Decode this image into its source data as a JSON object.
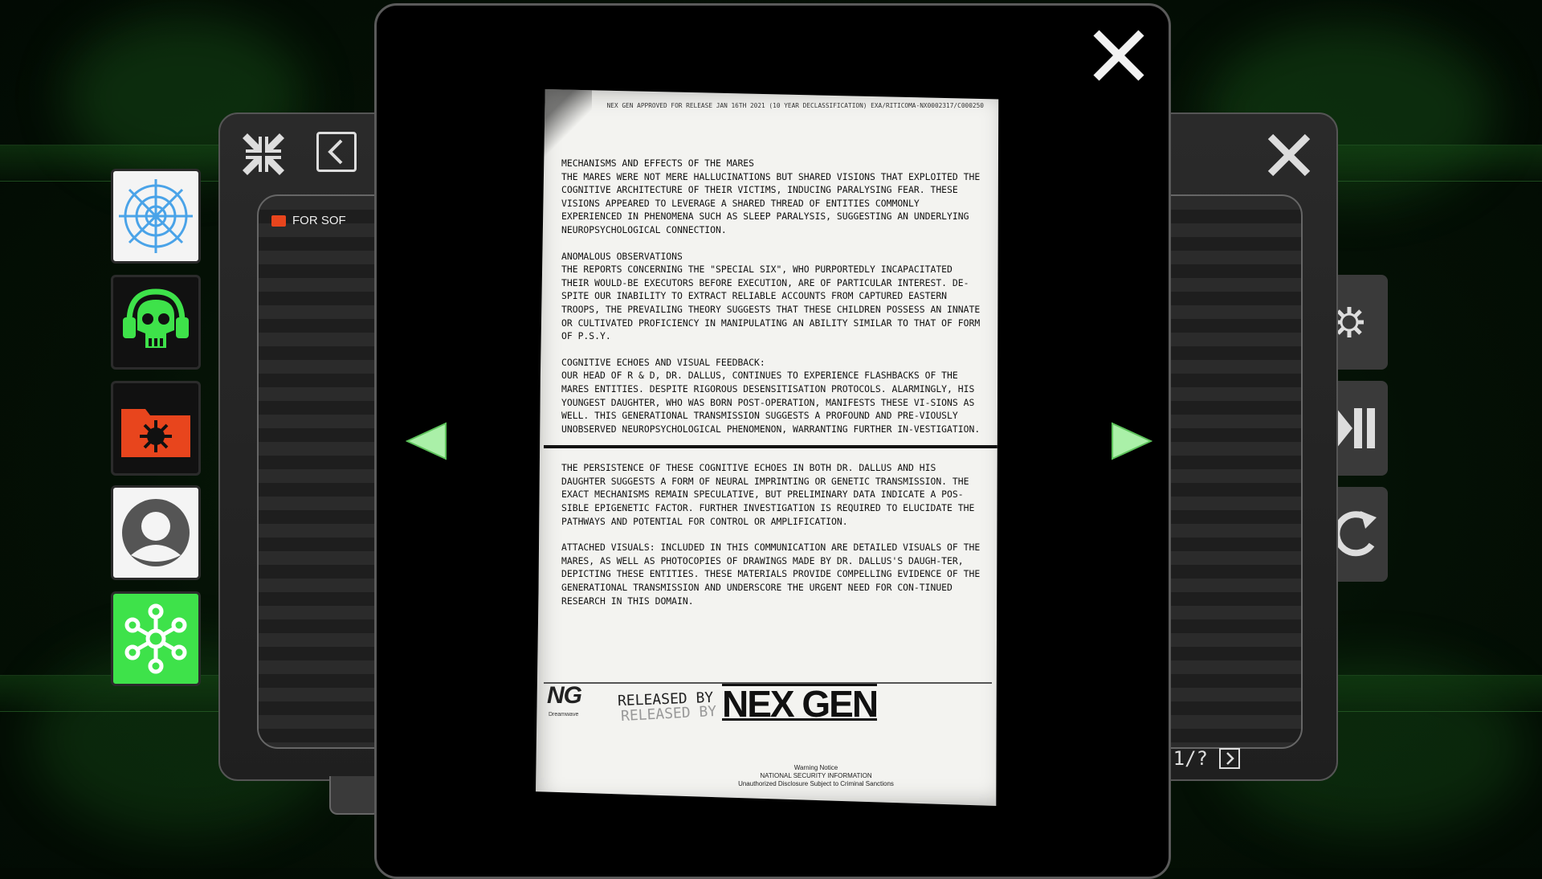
{
  "folder": {
    "label": "FOR SOF"
  },
  "pager": {
    "current": "1",
    "sep": "/",
    "total": "?"
  },
  "document": {
    "header": "NEX GEN approved for release JAN 16th 2021 (10 year declassification) EXA/RITICOMA-NX0002317/C000250",
    "sections": [
      {
        "title": "MECHANISMS AND EFFECTS OF THE MARES",
        "body": "THE MARES WERE NOT MERE HALLUCINATIONS BUT SHARED VISIONS THAT EXPLOITED THE COGNITIVE ARCHITECTURE OF THEIR VICTIMS, INDUCING PARALYSING FEAR. THESE VISIONS APPEARED TO LEVERAGE A SHARED THREAD OF ENTITIES COMMONLY EXPERIENCED IN PHENOMENA SUCH AS SLEEP PARALYSIS, SUGGESTING AN UNDERLYING NEUROPSYCHOLOGICAL CONNECTION."
      },
      {
        "title": "ANOMALOUS OBSERVATIONS",
        "body": "THE REPORTS CONCERNING THE \"SPECIAL SIX\", WHO PURPORTEDLY INCAPACITATED THEIR WOULD-BE EXECUTORS BEFORE EXECUTION, ARE OF PARTICULAR INTEREST. DE-SPITE OUR INABILITY TO EXTRACT RELIABLE ACCOUNTS FROM CAPTURED EASTERN TROOPS, THE PREVAILING THEORY SUGGESTS THAT THESE CHILDREN POSSESS AN INNATE OR CULTIVATED PROFICIENCY IN MANIPULATING AN ABILITY SIMILAR TO THAT OF FORM OF P.S.Y."
      },
      {
        "title": "COGNITIVE ECHOES AND VISUAL FEEDBACK:",
        "body": "OUR HEAD OF R & D, DR. DALLUS, CONTINUES TO EXPERIENCE FLASHBACKS OF THE MARES ENTITIES. DESPITE RIGOROUS DESENSITISATION PROTOCOLS. ALARMINGLY, HIS YOUNGEST DAUGHTER, WHO WAS BORN POST-OPERATION, MANIFESTS THESE VI-SIONS AS WELL. THIS GENERATIONAL TRANSMISSION SUGGESTS A PROFOUND AND PRE-VIOUSLY UNOBSERVED NEUROPSYCHOLOGICAL PHENOMENON, WARRANTING FURTHER IN-VESTIGATION."
      }
    ],
    "para_persistence": "THE PERSISTENCE OF THESE COGNITIVE ECHOES IN BOTH DR. DALLUS AND HIS DAUGHTER SUGGESTS A FORM OF NEURAL IMPRINTING OR GENETIC TRANSMISSION. THE EXACT MECHANISMS REMAIN SPECULATIVE, BUT PRELIMINARY DATA INDICATE A POS-SIBLE EPIGENETIC FACTOR. FURTHER INVESTIGATION IS REQUIRED TO ELUCIDATE THE PATHWAYS AND POTENTIAL FOR CONTROL OR AMPLIFICATION.",
    "para_attached": "ATTACHED VISUALS: INCLUDED IN THIS COMMUNICATION ARE DETAILED VISUALS OF THE MARES, AS WELL AS PHOTOCOPIES OF DRAWINGS MADE BY DR. DALLUS'S DAUGH-TER, DEPICTING THESE ENTITIES. THESE MATERIALS PROVIDE COMPELLING EVIDENCE OF THE GENERATIONAL TRANSMISSION AND UNDERSCORE THE URGENT NEED FOR CON-TINUED RESEARCH IN THIS DOMAIN.",
    "footer": {
      "ng_mark": "NG",
      "ng_sub": "Dreamwave",
      "released_by": "RELEASED BY",
      "released_by_faded": "RELEASED BY",
      "nexgen": "NEX GEN",
      "warning_title": "Warning Notice",
      "warning_line1": "NATIONAL SECURITY INFORMATION",
      "warning_line2": "Unauthorized Disclosure Subject to Criminal Sanctions"
    }
  },
  "colors": {
    "accent_green": "#3ee24a",
    "folder_orange": "#e8451d",
    "web_blue": "#4aa3e8"
  },
  "icons": [
    "web-icon",
    "skull-headphones-icon",
    "virus-folder-icon",
    "user-icon",
    "molecule-icon"
  ]
}
